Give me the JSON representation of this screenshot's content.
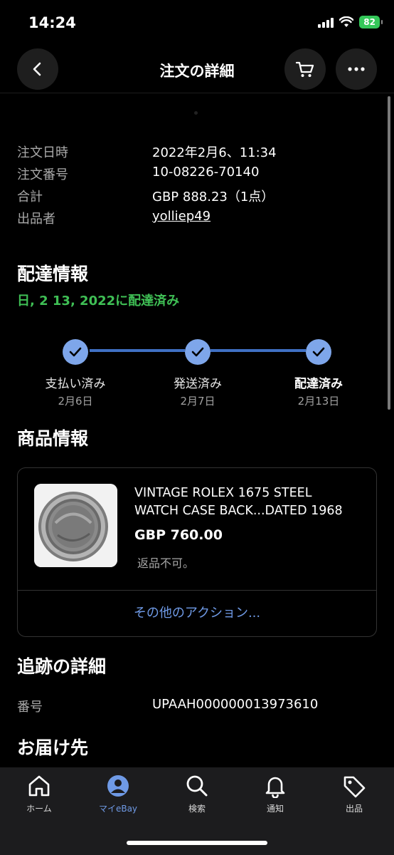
{
  "status_bar": {
    "time": "14:24",
    "battery": "82"
  },
  "header": {
    "title": "注文の詳細"
  },
  "order": {
    "date_label": "注文日時",
    "date_value": "2022年2月6、11:34",
    "number_label": "注文番号",
    "number_value": "10-08226-70140",
    "total_label": "合計",
    "total_value": "GBP 888.23（1点）",
    "seller_label": "出品者",
    "seller_value": "yolliep49"
  },
  "delivery": {
    "title": "配達情報",
    "status": "日, 2 13, 2022に配達済み",
    "steps": [
      {
        "label": "支払い済み",
        "date": "2月6日"
      },
      {
        "label": "発送済み",
        "date": "2月7日"
      },
      {
        "label": "配達済み",
        "date": "2月13日"
      }
    ]
  },
  "product": {
    "section_title": "商品情報",
    "title_line1": "VINTAGE ROLEX 1675 STEEL",
    "title_line2": "WATCH CASE BACK...DATED 1968",
    "price": "GBP 760.00",
    "return_policy": "返品不可。",
    "more_actions": "その他のアクション..."
  },
  "tracking": {
    "title": "追跡の詳細",
    "number_label": "番号",
    "number_value": "UPAAH000000013973610"
  },
  "shipping": {
    "title": "お届け先"
  },
  "tabbar": {
    "items": [
      {
        "label": "ホーム",
        "icon": "home-icon"
      },
      {
        "label": "マイeBay",
        "icon": "profile-icon"
      },
      {
        "label": "検索",
        "icon": "search-icon"
      },
      {
        "label": "通知",
        "icon": "bell-icon"
      },
      {
        "label": "出品",
        "icon": "tag-icon"
      }
    ],
    "active_index": 1
  },
  "colors": {
    "accent": "#6f9ae6",
    "success": "#3fbf55",
    "step": "#7ea6ea"
  }
}
